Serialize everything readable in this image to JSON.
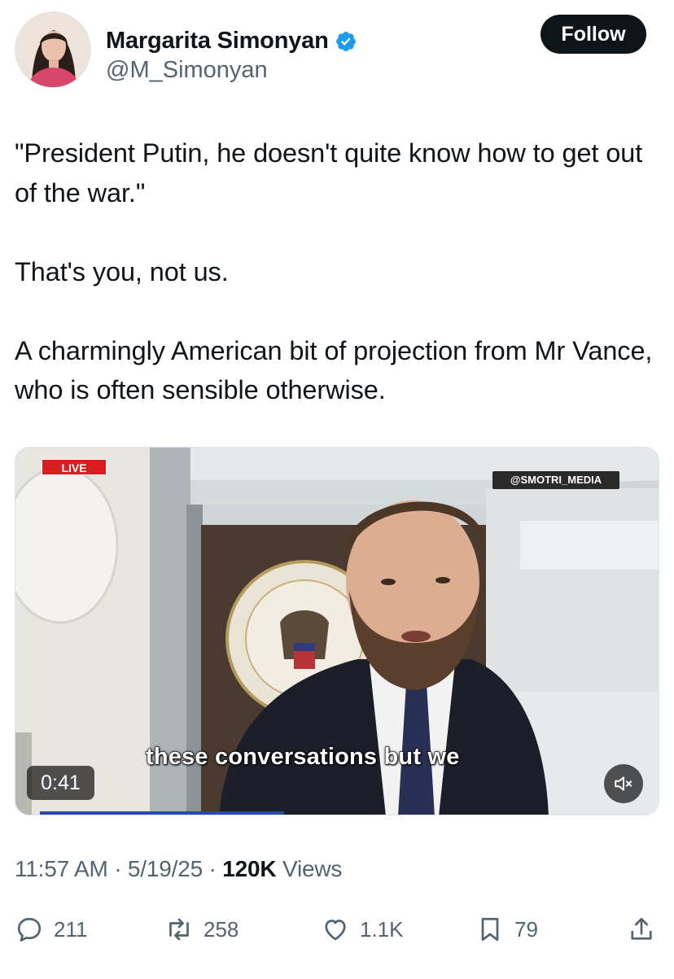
{
  "author": {
    "name": "Margarita Simonyan",
    "handle": "@M_Simonyan",
    "verified_color": "#1d9bf0"
  },
  "follow_button": {
    "label": "Follow"
  },
  "tweet": {
    "paragraphs": [
      "\"President Putin, he doesn't quite know how to get out of the war.\"",
      "That's you, not us.",
      "A charmingly American bit of projection from Mr Vance, who is often sensible otherwise."
    ]
  },
  "media": {
    "live_badge": "LIVE",
    "watermark": "@SMOTRI_MEDIA",
    "caption": "these conversations but we",
    "duration": "0:41",
    "mute_icon": "speaker-muted-icon"
  },
  "meta": {
    "time": "11:57 AM",
    "sep1": " · ",
    "date": "5/19/25",
    "sep2": " · ",
    "views_count": "120K",
    "views_label": " Views"
  },
  "actions": {
    "replies": {
      "icon": "reply-icon",
      "count": "211"
    },
    "reposts": {
      "icon": "repost-icon",
      "count": "258"
    },
    "likes": {
      "icon": "heart-icon",
      "count": "1.1K"
    },
    "bookmarks": {
      "icon": "bookmark-icon",
      "count": "79"
    },
    "share": {
      "icon": "share-icon"
    }
  }
}
